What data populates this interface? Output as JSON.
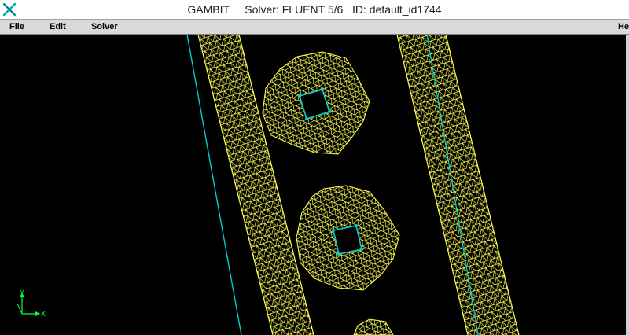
{
  "window": {
    "title_parts": [
      "GAMBIT",
      "Solver: FLUENT 5/6",
      "ID: default_id1744"
    ],
    "title": "GAMBIT     Solver: FLUENT 5/6   ID: default_id1744"
  },
  "menu": {
    "file": "File",
    "edit": "Edit",
    "solver": "Solver",
    "help": "He"
  },
  "axes": {
    "y_label": "Y",
    "x_label": "X"
  },
  "colors": {
    "background": "#000000",
    "mesh": "#ffff55",
    "boundary": "#00d0d0",
    "triad": "#00ff40"
  },
  "icons": {
    "app": "gambit-x-icon"
  }
}
